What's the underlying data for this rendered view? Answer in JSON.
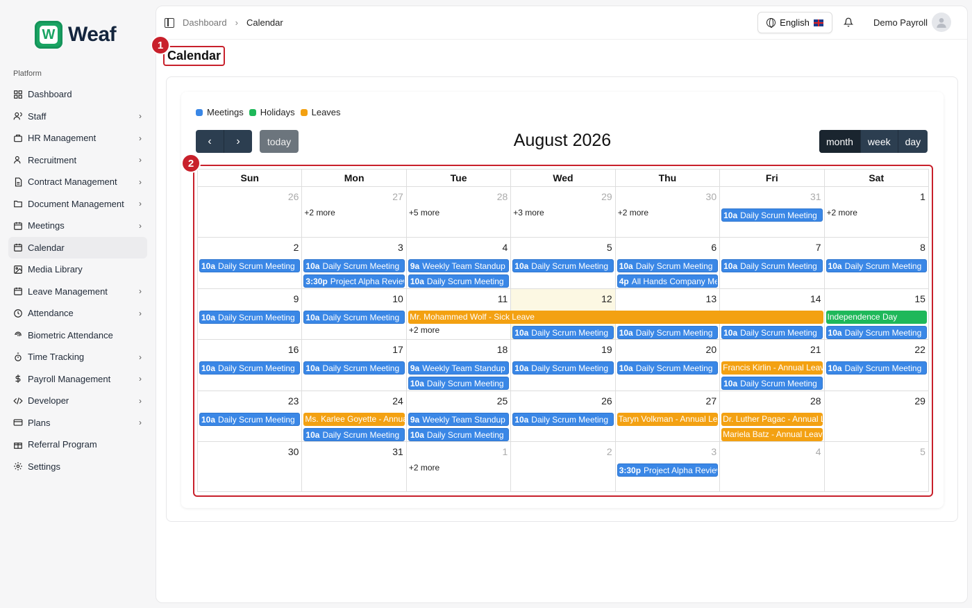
{
  "brand": {
    "mark": "W",
    "name": "Weaf"
  },
  "sidebar": {
    "section": "Platform",
    "items": [
      {
        "label": "Dashboard",
        "icon": "grid-icon",
        "chevron": false
      },
      {
        "label": "Staff",
        "icon": "users-icon",
        "chevron": true
      },
      {
        "label": "HR Management",
        "icon": "briefcase-icon",
        "chevron": true
      },
      {
        "label": "Recruitment",
        "icon": "user-plus-icon",
        "chevron": true
      },
      {
        "label": "Contract Management",
        "icon": "file-icon",
        "chevron": true
      },
      {
        "label": "Document Management",
        "icon": "folder-icon",
        "chevron": true
      },
      {
        "label": "Meetings",
        "icon": "calendar-icon",
        "chevron": true
      },
      {
        "label": "Calendar",
        "icon": "calendar-icon",
        "chevron": false,
        "active": true
      },
      {
        "label": "Media Library",
        "icon": "image-icon",
        "chevron": false
      },
      {
        "label": "Leave Management",
        "icon": "calendar-icon",
        "chevron": true
      },
      {
        "label": "Attendance",
        "icon": "clock-icon",
        "chevron": true
      },
      {
        "label": "Biometric Attendance",
        "icon": "fingerprint-icon",
        "chevron": false
      },
      {
        "label": "Time Tracking",
        "icon": "timer-icon",
        "chevron": true
      },
      {
        "label": "Payroll Management",
        "icon": "dollar-icon",
        "chevron": true
      },
      {
        "label": "Developer",
        "icon": "code-icon",
        "chevron": true
      },
      {
        "label": "Plans",
        "icon": "card-icon",
        "chevron": true
      },
      {
        "label": "Referral Program",
        "icon": "gift-icon",
        "chevron": false
      },
      {
        "label": "Settings",
        "icon": "gear-icon",
        "chevron": false
      }
    ]
  },
  "topbar": {
    "breadcrumb": [
      "Dashboard",
      "Calendar"
    ],
    "language": "English",
    "user": "Demo Payroll"
  },
  "page": {
    "title": "Calendar",
    "badge1": "1",
    "badge2": "2"
  },
  "calendar": {
    "legend": [
      {
        "label": "Meetings",
        "color": "#3a87e6"
      },
      {
        "label": "Holidays",
        "color": "#1fb85a"
      },
      {
        "label": "Leaves",
        "color": "#f3a112"
      }
    ],
    "today_label": "today",
    "title": "August 2026",
    "views": [
      "month",
      "week",
      "day"
    ],
    "active_view": "month",
    "days_of_week": [
      "Sun",
      "Mon",
      "Tue",
      "Wed",
      "Thu",
      "Fri",
      "Sat"
    ],
    "weeks": [
      {
        "days": [
          {
            "num": "26",
            "other": true,
            "items": []
          },
          {
            "num": "27",
            "other": true,
            "items": [
              {
                "kind": "more",
                "text": "+2 more"
              }
            ]
          },
          {
            "num": "28",
            "other": true,
            "items": [
              {
                "kind": "more",
                "text": "+5 more"
              }
            ]
          },
          {
            "num": "29",
            "other": true,
            "items": [
              {
                "kind": "more",
                "text": "+3 more"
              }
            ]
          },
          {
            "num": "30",
            "other": true,
            "items": [
              {
                "kind": "more",
                "text": "+2 more"
              }
            ]
          },
          {
            "num": "31",
            "other": true,
            "items": [
              {
                "kind": "meet",
                "time": "10a",
                "text": "Daily Scrum Meeting"
              }
            ]
          },
          {
            "num": "1",
            "items": [
              {
                "kind": "more",
                "text": "+2 more"
              }
            ]
          }
        ]
      },
      {
        "days": [
          {
            "num": "2",
            "items": [
              {
                "kind": "meet",
                "time": "10a",
                "text": "Daily Scrum Meeting"
              }
            ]
          },
          {
            "num": "3",
            "items": [
              {
                "kind": "meet",
                "time": "10a",
                "text": "Daily Scrum Meeting"
              },
              {
                "kind": "meet",
                "time": "3:30p",
                "text": "Project Alpha Review"
              }
            ]
          },
          {
            "num": "4",
            "items": [
              {
                "kind": "meet",
                "time": "9a",
                "text": "Weekly Team Standup"
              },
              {
                "kind": "meet",
                "time": "10a",
                "text": "Daily Scrum Meeting"
              }
            ]
          },
          {
            "num": "5",
            "items": [
              {
                "kind": "meet",
                "time": "10a",
                "text": "Daily Scrum Meeting"
              }
            ]
          },
          {
            "num": "6",
            "items": [
              {
                "kind": "meet",
                "time": "10a",
                "text": "Daily Scrum Meeting"
              },
              {
                "kind": "meet",
                "time": "4p",
                "text": "All Hands Company Meeting"
              }
            ]
          },
          {
            "num": "7",
            "items": [
              {
                "kind": "meet",
                "time": "10a",
                "text": "Daily Scrum Meeting"
              }
            ]
          },
          {
            "num": "8",
            "items": [
              {
                "kind": "meet",
                "time": "10a",
                "text": "Daily Scrum Meeting"
              }
            ]
          }
        ]
      },
      {
        "days": [
          {
            "num": "9",
            "items": [
              {
                "kind": "meet",
                "time": "10a",
                "text": "Daily Scrum Meeting"
              }
            ]
          },
          {
            "num": "10",
            "items": [
              {
                "kind": "meet",
                "time": "10a",
                "text": "Daily Scrum Meeting"
              }
            ]
          },
          {
            "num": "11",
            "items": [
              {
                "kind": "gap"
              },
              {
                "kind": "more",
                "text": "+2 more"
              }
            ]
          },
          {
            "num": "12",
            "today": true,
            "items": [
              {
                "kind": "gap"
              },
              {
                "kind": "meet",
                "time": "10a",
                "text": "Daily Scrum Meeting"
              }
            ]
          },
          {
            "num": "13",
            "items": [
              {
                "kind": "gap"
              },
              {
                "kind": "meet",
                "time": "10a",
                "text": "Daily Scrum Meeting"
              }
            ]
          },
          {
            "num": "14",
            "items": [
              {
                "kind": "gap"
              },
              {
                "kind": "meet",
                "time": "10a",
                "text": "Daily Scrum Meeting"
              }
            ]
          },
          {
            "num": "15",
            "items": [
              {
                "kind": "hol",
                "text": "Independence Day"
              },
              {
                "kind": "meet",
                "time": "10a",
                "text": "Daily Scrum Meeting"
              }
            ]
          }
        ],
        "span": {
          "text": "Mr. Mohammed Wolf - Sick Leave",
          "start": 2,
          "end": 5
        }
      },
      {
        "days": [
          {
            "num": "16",
            "items": [
              {
                "kind": "meet",
                "time": "10a",
                "text": "Daily Scrum Meeting"
              }
            ]
          },
          {
            "num": "17",
            "items": [
              {
                "kind": "meet",
                "time": "10a",
                "text": "Daily Scrum Meeting"
              }
            ]
          },
          {
            "num": "18",
            "items": [
              {
                "kind": "meet",
                "time": "9a",
                "text": "Weekly Team Standup"
              },
              {
                "kind": "meet",
                "time": "10a",
                "text": "Daily Scrum Meeting"
              }
            ]
          },
          {
            "num": "19",
            "items": [
              {
                "kind": "meet",
                "time": "10a",
                "text": "Daily Scrum Meeting"
              }
            ]
          },
          {
            "num": "20",
            "items": [
              {
                "kind": "meet",
                "time": "10a",
                "text": "Daily Scrum Meeting"
              }
            ]
          },
          {
            "num": "21",
            "items": [
              {
                "kind": "leave",
                "text": "Francis Kirlin - Annual Leave"
              },
              {
                "kind": "meet",
                "time": "10a",
                "text": "Daily Scrum Meeting"
              }
            ]
          },
          {
            "num": "22",
            "items": [
              {
                "kind": "meet",
                "time": "10a",
                "text": "Daily Scrum Meeting"
              }
            ]
          }
        ]
      },
      {
        "days": [
          {
            "num": "23",
            "items": [
              {
                "kind": "meet",
                "time": "10a",
                "text": "Daily Scrum Meeting"
              }
            ]
          },
          {
            "num": "24",
            "items": [
              {
                "kind": "leave",
                "text": "Ms. Karlee Goyette - Annual Leave"
              },
              {
                "kind": "meet",
                "time": "10a",
                "text": "Daily Scrum Meeting"
              }
            ]
          },
          {
            "num": "25",
            "items": [
              {
                "kind": "meet",
                "time": "9a",
                "text": "Weekly Team Standup"
              },
              {
                "kind": "meet",
                "time": "10a",
                "text": "Daily Scrum Meeting"
              }
            ]
          },
          {
            "num": "26",
            "items": [
              {
                "kind": "meet",
                "time": "10a",
                "text": "Daily Scrum Meeting"
              }
            ]
          },
          {
            "num": "27",
            "items": [
              {
                "kind": "leave",
                "text": "Taryn Volkman - Annual Leave"
              }
            ]
          },
          {
            "num": "28",
            "items": [
              {
                "kind": "leave",
                "text": "Dr. Luther Pagac - Annual Leave"
              },
              {
                "kind": "leave",
                "text": "Mariela Batz - Annual Leave"
              }
            ]
          },
          {
            "num": "29",
            "items": []
          }
        ]
      },
      {
        "days": [
          {
            "num": "30",
            "items": []
          },
          {
            "num": "31",
            "items": []
          },
          {
            "num": "1",
            "other": true,
            "items": [
              {
                "kind": "more",
                "text": "+2 more"
              }
            ]
          },
          {
            "num": "2",
            "other": true,
            "items": []
          },
          {
            "num": "3",
            "other": true,
            "items": [
              {
                "kind": "meet",
                "time": "3:30p",
                "text": "Project Alpha Review"
              }
            ]
          },
          {
            "num": "4",
            "other": true,
            "items": []
          },
          {
            "num": "5",
            "other": true,
            "items": []
          }
        ]
      }
    ]
  }
}
